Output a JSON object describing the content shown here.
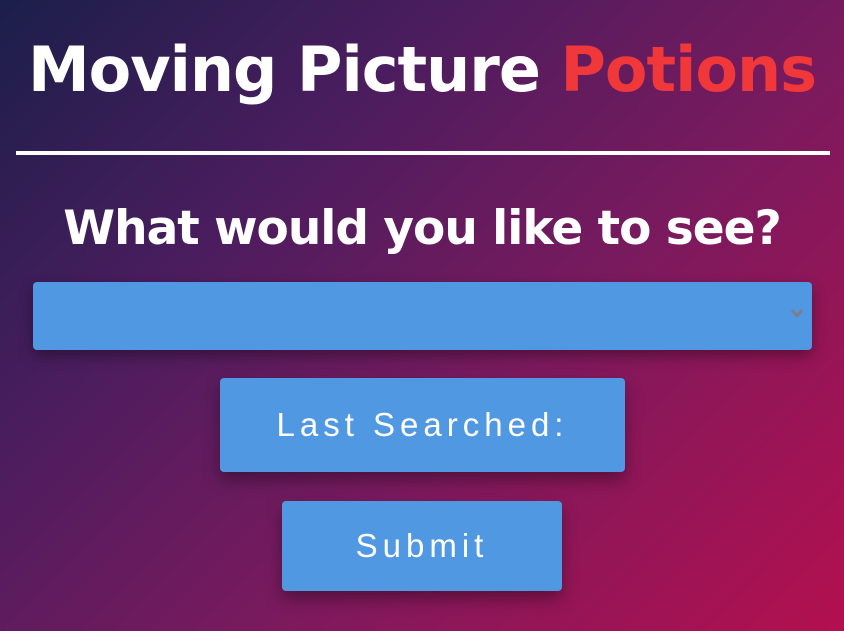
{
  "header": {
    "title_main": "Moving Picture",
    "title_accent": "Potions"
  },
  "search": {
    "prompt": "What would you like to see?",
    "select_value": ""
  },
  "buttons": {
    "last_searched_label": "Last Searched:",
    "submit_label": "Submit"
  },
  "icons": {
    "dropdown": "chevron-down-icon"
  },
  "colors": {
    "accent": "#f0373a",
    "button": "#5198e3",
    "text": "#ffffff"
  }
}
